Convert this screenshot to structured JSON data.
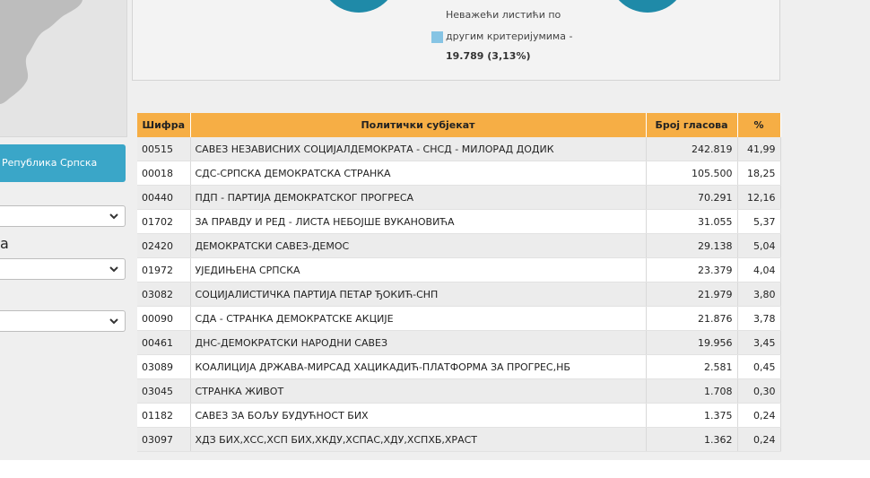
{
  "sidebar": {
    "region_button": "Републикa Српска",
    "partial_label": "а",
    "colors": {
      "button": "#3aa6c8",
      "map": "#bdbdbd"
    }
  },
  "summary": {
    "invalid_line1": "Неважећи листићи по",
    "invalid_line2": "другим критеријумима -",
    "invalid_value": "19.789 (3,13%)",
    "colors": {
      "circle": "#1f8aa8",
      "legend": "#86c4e4"
    }
  },
  "table": {
    "headers": [
      "Шифра",
      "Политички субјекат",
      "Број гласова",
      "%"
    ],
    "header_color": "#f6ae45",
    "rows": [
      {
        "code": "00515",
        "name": "САВЕЗ НЕЗАВИСНИХ СОЦИЈАЛДЕМОКРАТА - СНСД - МИЛОРАД ДОДИК",
        "votes": "242.819",
        "pct": "41,99"
      },
      {
        "code": "00018",
        "name": "СДС-СРПСКА ДЕМОКРАТСКА СТРАНКА",
        "votes": "105.500",
        "pct": "18,25"
      },
      {
        "code": "00440",
        "name": "ПДП - ПАРТИЈА ДЕМОКРАТСКОГ ПРОГРЕСА",
        "votes": "70.291",
        "pct": "12,16"
      },
      {
        "code": "01702",
        "name": "ЗА ПРАВДУ И РЕД - ЛИСТА НЕБОЈШЕ ВУКАНОВИЋА",
        "votes": "31.055",
        "pct": "5,37"
      },
      {
        "code": "02420",
        "name": "ДЕМОКРАТСКИ САВЕЗ-ДЕМОС",
        "votes": "29.138",
        "pct": "5,04"
      },
      {
        "code": "01972",
        "name": "УЈЕДИЊЕНА СРПСКА",
        "votes": "23.379",
        "pct": "4,04"
      },
      {
        "code": "03082",
        "name": "СОЦИЈАЛИСТИЧКА ПАРТИЈА ПЕТАР ЂОКИЋ-СНП",
        "votes": "21.979",
        "pct": "3,80"
      },
      {
        "code": "00090",
        "name": "СДА - СТРАНКА ДЕМОКРАТСКЕ АКЦИЈЕ",
        "votes": "21.876",
        "pct": "3,78"
      },
      {
        "code": "00461",
        "name": "ДНС-ДЕМОКРАТСКИ НАРОДНИ САВЕЗ",
        "votes": "19.956",
        "pct": "3,45"
      },
      {
        "code": "03089",
        "name": "КОАЛИЦИЈА ДРЖАВА-МИРСАД ХАЦИКАДИЋ-ПЛАТФОРМА ЗА ПРОГРЕС,НБ",
        "votes": "2.581",
        "pct": "0,45"
      },
      {
        "code": "03045",
        "name": "СТРАНКА ЖИВОТ",
        "votes": "1.708",
        "pct": "0,30"
      },
      {
        "code": "01182",
        "name": "САВЕЗ ЗА БОЉУ БУДУЋНОСТ БИХ",
        "votes": "1.375",
        "pct": "0,24"
      },
      {
        "code": "03097",
        "name": "ХДЗ БИХ,ХСС,ХСП БИХ,ХКДУ,ХСПАС,ХДУ,ХСПХБ,ХРАСТ",
        "votes": "1.362",
        "pct": "0,24"
      }
    ]
  }
}
